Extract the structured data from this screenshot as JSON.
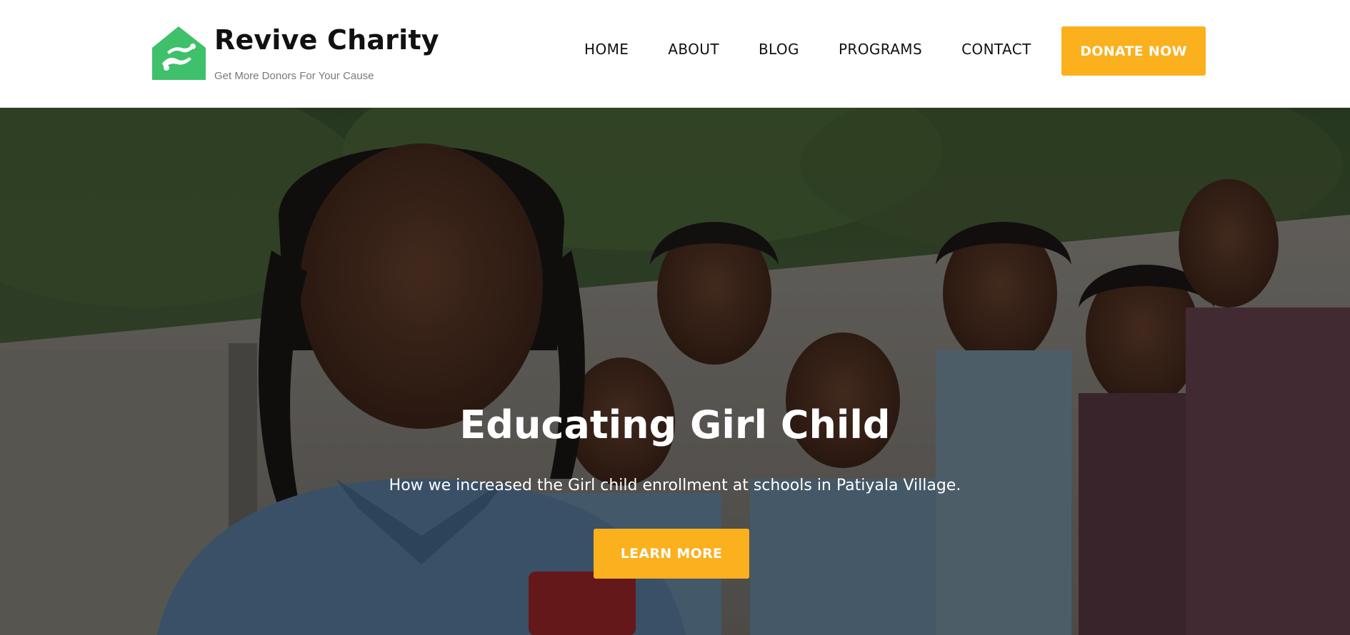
{
  "brand": {
    "name": "Revive Charity",
    "tagline": "Get More Donors For Your Cause",
    "logo_icon": "helping-hands-house-icon",
    "logo_color": "#3fc06a"
  },
  "nav": {
    "items": [
      {
        "label": "HOME"
      },
      {
        "label": "ABOUT"
      },
      {
        "label": "BLOG"
      },
      {
        "label": "PROGRAMS"
      },
      {
        "label": "CONTACT"
      }
    ],
    "cta_label": "DONATE NOW"
  },
  "hero": {
    "title": "Educating Girl Child",
    "subtitle": "How we increased the Girl child enrollment at schools in Patiyala Village.",
    "button_label": "LEARN MORE",
    "image": "photo of schoolgirls in blue uniforms"
  },
  "colors": {
    "accent": "#fbb01e",
    "logo_green": "#3fc06a",
    "text_dark": "#111111",
    "tagline_gray": "#7a7a7a"
  }
}
